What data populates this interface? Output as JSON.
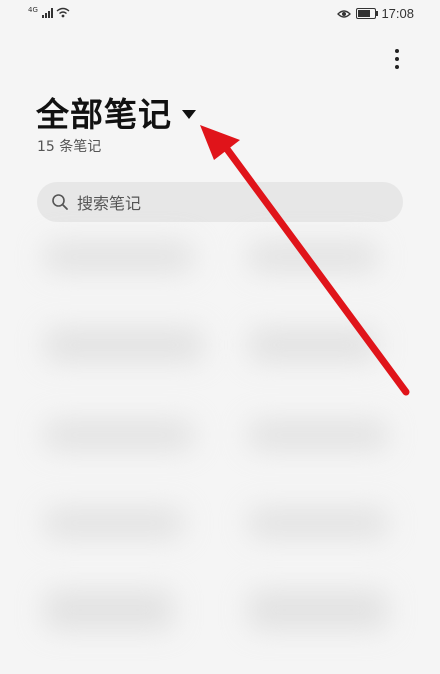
{
  "status_bar": {
    "network_type": "4G",
    "time": "17:08",
    "battery_level": 0.7,
    "icons": [
      "signal-icon",
      "wifi-icon",
      "eye-comfort-icon",
      "battery-icon"
    ]
  },
  "header": {
    "title": "全部笔记",
    "note_count": "15 条笔记",
    "menu_icon": "more-vertical-icon",
    "dropdown_icon": "dropdown-triangle-icon"
  },
  "search": {
    "placeholder": "搜索笔记",
    "icon": "search-icon"
  },
  "annotation": {
    "color": "#e0141a",
    "icon": "red-arrow-annotation"
  },
  "colors": {
    "background": "#f5f5f5",
    "search_bg": "#e7e7e7",
    "text_primary": "#111111"
  }
}
